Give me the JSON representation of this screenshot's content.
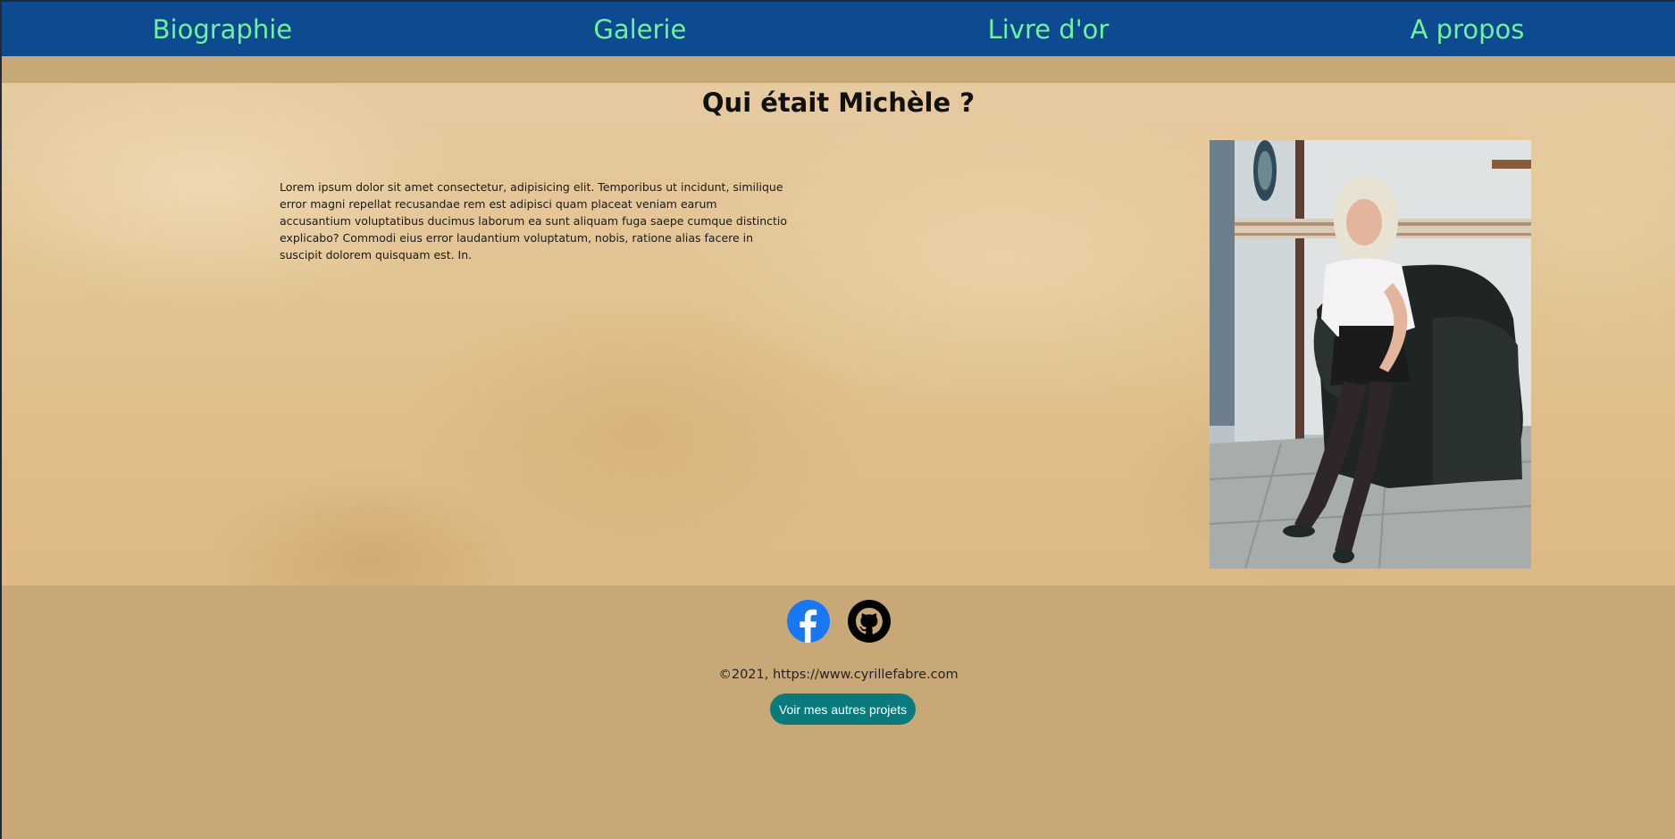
{
  "nav": {
    "items": [
      {
        "label": "Biographie"
      },
      {
        "label": "Galerie"
      },
      {
        "label": "Livre d'or"
      },
      {
        "label": "A propos"
      }
    ]
  },
  "main": {
    "title": "Qui était Michèle ?",
    "bio_text": "Lorem ipsum dolor sit amet consectetur, adipisicing elit. Temporibus ut incidunt, similique error magni repellat recusandae rem est adipisci quam placeat veniam earum accusantium voluptatibus ducimus laborum ea sunt aliquam fuga saepe cumque distinctio explicabo? Commodi eius error laudantium voluptatum, nobis, ratione alias facere in suscipit dolorem quisquam est. In.",
    "photo": {
      "subject": "portrait-photo"
    }
  },
  "footer": {
    "social": [
      {
        "icon": "facebook-icon"
      },
      {
        "icon": "github-icon"
      }
    ],
    "copyright": "©2021, https://www.cyrillefabre.com",
    "projects_button": "Voir mes autres projets"
  },
  "colors": {
    "nav_bg": "#0e4a8f",
    "nav_text": "#6ff29a",
    "page_bg": "#c9a878",
    "button_bg": "#0a7b7c",
    "facebook": "#1877f2"
  }
}
